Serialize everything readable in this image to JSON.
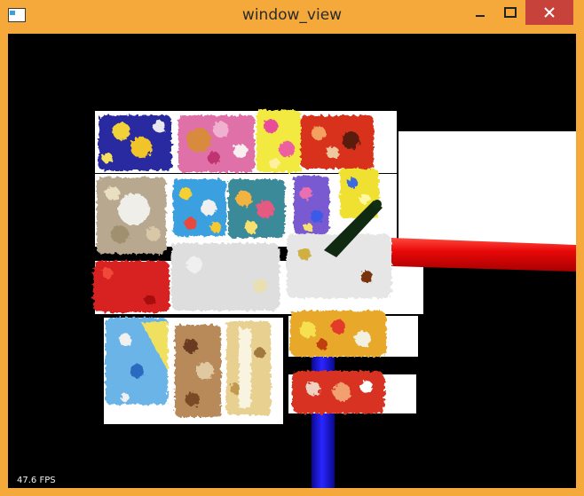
{
  "window": {
    "title": "window_view",
    "controls": {
      "minimize_icon": "minimize-icon",
      "maximize_icon": "maximize-icon",
      "close_icon": "close-icon"
    }
  },
  "viewport": {
    "fps_text": "47.6 FPS",
    "colors": {
      "background": "#000000",
      "frame": "#f6a93b",
      "red_axis": "#e8090a",
      "blue_axis": "#1d17e0",
      "green_axis": "#0f2a10"
    }
  }
}
